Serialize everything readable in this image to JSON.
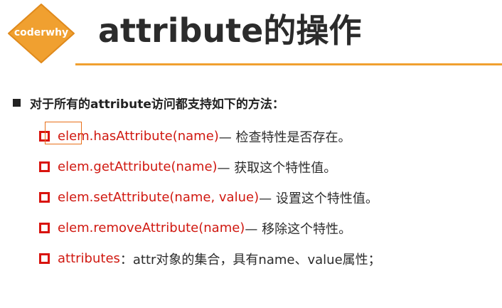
{
  "logo": {
    "text": "coderwhy"
  },
  "title": "attribute的操作",
  "main_bullet": "对于所有的attribute访问都支持如下的方法：",
  "items": [
    {
      "code": "elem.hasAttribute(name)",
      "desc": " — 检查特性是否存在。"
    },
    {
      "code": "elem.getAttribute(name)",
      "desc": " — 获取这个特性值。"
    },
    {
      "code": "elem.setAttribute(name, value)",
      "desc": " — 设置这个特性值。"
    },
    {
      "code": "elem.removeAttribute(name)",
      "desc": " — 移除这个特性。"
    },
    {
      "code": "attributes",
      "desc": "：attr对象的集合，具有name、value属性；"
    }
  ],
  "colors": {
    "accent": "#f0a030",
    "code_red": "#d01810",
    "text": "#2b2b2b"
  }
}
